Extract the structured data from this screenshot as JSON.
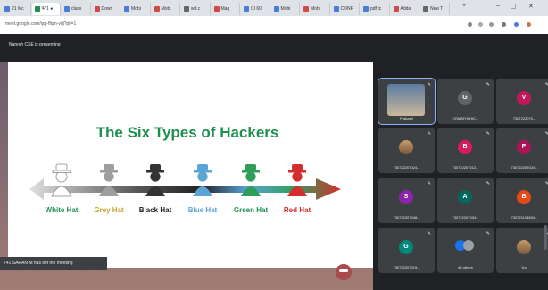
{
  "browser": {
    "tabs": [
      {
        "label": "21 Mc",
        "color": "#4a7bd8"
      },
      {
        "label": "Ψ 1 ●",
        "color": "#1e8f4f",
        "active": true
      },
      {
        "label": "class",
        "color": "#4a7bd8"
      },
      {
        "label": "Down",
        "color": "#d04a4a"
      },
      {
        "label": "Mobi",
        "color": "#4a7bd8"
      },
      {
        "label": "Mobi",
        "color": "#d04a4a"
      },
      {
        "label": "wd.c",
        "color": "#666666"
      },
      {
        "label": "Mag",
        "color": "#d04a4a"
      },
      {
        "label": "CI 60",
        "color": "#4a7bd8"
      },
      {
        "label": "Mobi",
        "color": "#4a7bd8"
      },
      {
        "label": "Mobi",
        "color": "#d04a4a"
      },
      {
        "label": "CONF",
        "color": "#4a7bd8"
      },
      {
        "label": "pdf tc",
        "color": "#4a7bd8"
      },
      {
        "label": "Adda",
        "color": "#d04a4a"
      },
      {
        "label": "New T",
        "color": "#666666"
      }
    ],
    "url": "meet.google.com/qqi-ffqm-vdj?pli=1"
  },
  "meet": {
    "presenting_label": "Naresh CSE is presenting",
    "toast": "741 SARAN M has left the meeting"
  },
  "slide": {
    "title": "The Six Types of Hackers",
    "hackers": [
      {
        "label": "White Hat",
        "label_color": "#1e8f4f",
        "hat_color": "#ffffff"
      },
      {
        "label": "Grey Hat",
        "label_color": "#c9a227",
        "hat_color": "#9e9e9e"
      },
      {
        "label": "Black Hat",
        "label_color": "#222222",
        "hat_color": "#333333"
      },
      {
        "label": "Blue Hat",
        "label_color": "#5aa5d6",
        "hat_color": "#5aa5d6"
      },
      {
        "label": "Green Hat",
        "label_color": "#1e8f4f",
        "hat_color": "#2f9e5a"
      },
      {
        "label": "Red Hat",
        "label_color": "#d32f2f",
        "hat_color": "#d32f2f"
      }
    ]
  },
  "participants": [
    {
      "name": "Prakash",
      "type": "photo"
    },
    {
      "name": "GOMATHI HIC...",
      "initial": "G",
      "color": "#5f6368"
    },
    {
      "name": "7307222070...",
      "initial": "V",
      "color": "#c2185b"
    },
    {
      "name": "730722207024...",
      "type": "photo"
    },
    {
      "name": "730722207012...",
      "initial": "B",
      "color": "#d81b60"
    },
    {
      "name": "730722207024...",
      "initial": "P",
      "color": "#ad1457"
    },
    {
      "name": "730722207048...",
      "initial": "S",
      "color": "#8e24aa"
    },
    {
      "name": "730722207034...",
      "initial": "A",
      "color": "#00695c"
    },
    {
      "name": "730721104804...",
      "initial": "B",
      "color": "#e64a19"
    },
    {
      "name": "730722207019...",
      "initial": "G",
      "color": "#00897b"
    },
    {
      "name": "46 others",
      "type": "others"
    },
    {
      "name": "You",
      "type": "photo"
    }
  ]
}
